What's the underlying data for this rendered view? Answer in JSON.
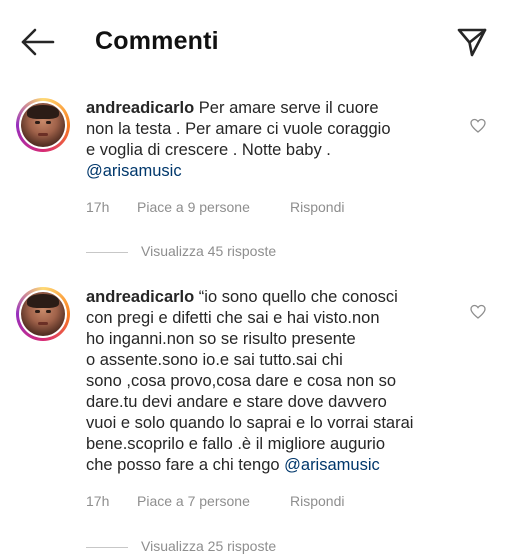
{
  "header": {
    "title": "Commenti",
    "back_icon": "arrow-left-icon",
    "send_icon": "paper-plane-icon"
  },
  "comments": [
    {
      "username": "andreadicarlo",
      "lines": [
        " Per amare serve il cuore",
        "non la testa .  Per amare ci vuole coraggio",
        "e voglia di crescere . Notte baby ."
      ],
      "mention": "@arisamusic",
      "age": "17h",
      "likes": "Piace a 9 persone",
      "reply": "Rispondi",
      "view_replies": "Visualizza 45 risposte"
    },
    {
      "username": "andreadicarlo",
      "lines": [
        " “io sono quello che conosci",
        "con pregi e difetti che sai e hai visto.non",
        "ho inganni.non so se risulto presente",
        "o assente.sono io.e sai tutto.sai chi",
        "sono ,cosa provo,cosa dare e cosa non so",
        "dare.tu devi andare e stare dove davvero",
        "vuoi e solo quando lo saprai e lo vorrai starai",
        "bene.scoprilo e fallo .è il migliore augurio",
        "che posso fare a chi tengo "
      ],
      "mention": "@arisamusic",
      "age": "17h",
      "likes": "Piace a 7 persone",
      "reply": "Rispondi",
      "view_replies": "Visualizza 25 risposte"
    }
  ],
  "colors": {
    "text": "#262626",
    "meta": "#8e8e8e",
    "mention": "#00376b",
    "divider": "#c7c7c7"
  }
}
